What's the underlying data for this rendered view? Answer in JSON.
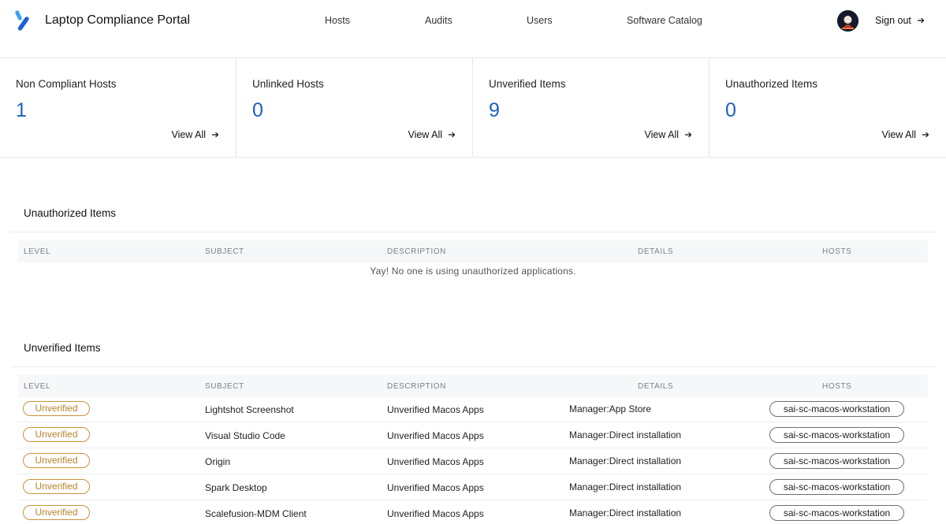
{
  "header": {
    "app_title": "Laptop Compliance Portal",
    "nav": [
      "Hosts",
      "Audits",
      "Users",
      "Software Catalog"
    ],
    "sign_out": "Sign out"
  },
  "stats": [
    {
      "label": "Non Compliant Hosts",
      "value": "1",
      "link": "View All"
    },
    {
      "label": "Unlinked Hosts",
      "value": "0",
      "link": "View All"
    },
    {
      "label": "Unverified Items",
      "value": "9",
      "link": "View All"
    },
    {
      "label": "Unauthorized Items",
      "value": "0",
      "link": "View All"
    }
  ],
  "columns": [
    "LEVEL",
    "SUBJECT",
    "DESCRIPTION",
    "DETAILS",
    "HOSTS"
  ],
  "unauthorized": {
    "title": "Unauthorized Items",
    "empty_message": "Yay! No one is using unauthorized applications."
  },
  "unverified": {
    "title": "Unverified Items",
    "rows": [
      {
        "level": "Unverified",
        "subject": "Lightshot Screenshot",
        "description": "Unverified Macos Apps",
        "details": "Manager:App Store",
        "host": "sai-sc-macos-workstation"
      },
      {
        "level": "Unverified",
        "subject": "Visual Studio Code",
        "description": "Unverified Macos Apps",
        "details": "Manager:Direct installation",
        "host": "sai-sc-macos-workstation"
      },
      {
        "level": "Unverified",
        "subject": "Origin",
        "description": "Unverified Macos Apps",
        "details": "Manager:Direct installation",
        "host": "sai-sc-macos-workstation"
      },
      {
        "level": "Unverified",
        "subject": "Spark Desktop",
        "description": "Unverified Macos Apps",
        "details": "Manager:Direct installation",
        "host": "sai-sc-macos-workstation"
      },
      {
        "level": "Unverified",
        "subject": "Scalefusion-MDM Client",
        "description": "Unverified Macos Apps",
        "details": "Manager:Direct installation",
        "host": "sai-sc-macos-workstation"
      }
    ]
  },
  "colors": {
    "accent": "#1f5fbf",
    "badge": "#c8933a"
  },
  "icons": {
    "logo": "brand-logo",
    "arrow": "arrow-right-icon"
  }
}
